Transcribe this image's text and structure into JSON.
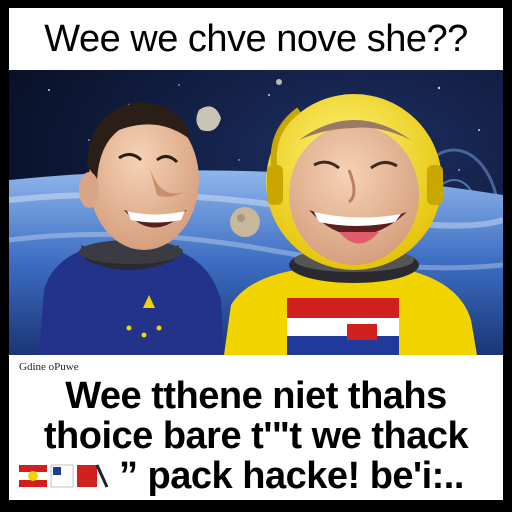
{
  "top_caption": "Wee  we chve nove she??",
  "bottom": {
    "small_label": "Gdine oPuwe",
    "line1": "Wee tthene niet thahs",
    "line2": "thoice bare t'\"t we thack",
    "line3": "” pack hacke! be'i:.."
  },
  "colors": {
    "space": "#0b1a3a",
    "earth_blue": "#3a6cc4",
    "yellow_suit": "#f2d400",
    "blue_suit": "#23338a",
    "flag_red": "#d02020"
  }
}
